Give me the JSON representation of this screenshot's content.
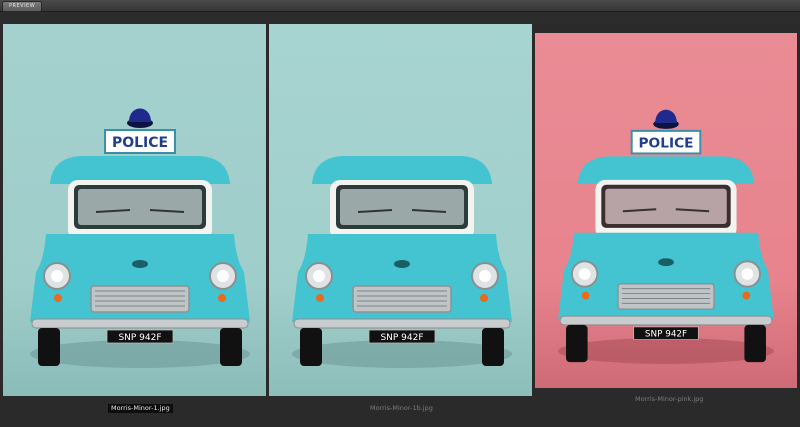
{
  "toolbar": {
    "tab_label": "PREVIEW"
  },
  "images": [
    {
      "caption": "Morris-Minor-1.jpg",
      "plate": "SNP 942F",
      "sign": "POLICE",
      "background": "#a7d2cf",
      "selected": true
    },
    {
      "caption": "Morris-Minor-1b.jpg",
      "plate": "SNP 942F",
      "sign": "POLICE",
      "background": "#a8d4d0",
      "selected": false
    },
    {
      "caption": "Morris-Minor-pink.jpg",
      "plate": "SNP 942F",
      "sign": "POLICE",
      "background": "#e98a93",
      "selected": false
    }
  ],
  "colors": {
    "car_body": "#44c4d1",
    "chrome": "#c9ccce",
    "window_frame": "#f3f3f0",
    "beacon": "#1f2a8c"
  }
}
